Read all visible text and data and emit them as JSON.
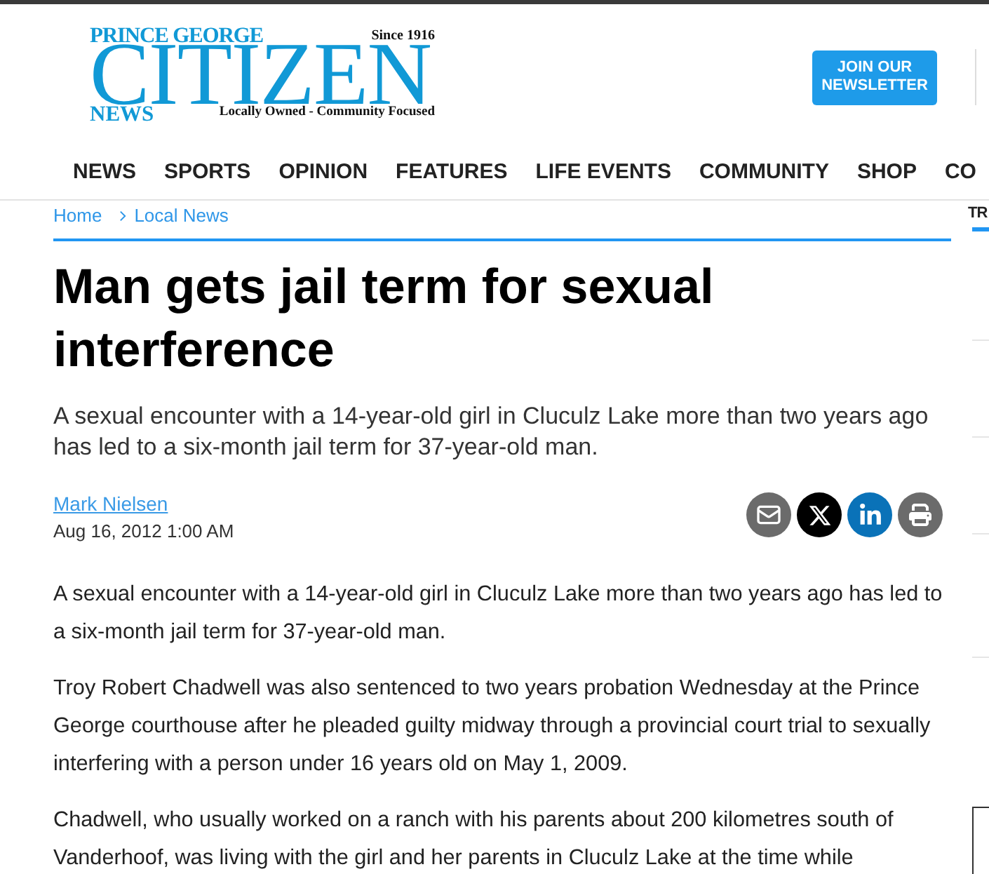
{
  "header": {
    "logo": {
      "top_line": "PRINCE GEORGE",
      "since": "Since 1916",
      "wordmark": "CITIZEN",
      "bottom_line": "NEWS",
      "tagline": "Locally Owned - Community Focused"
    },
    "newsletter_button": "JOIN OUR NEWSLETTER"
  },
  "nav": [
    {
      "label": "NEWS"
    },
    {
      "label": "SPORTS"
    },
    {
      "label": "OPINION"
    },
    {
      "label": "FEATURES"
    },
    {
      "label": "LIFE EVENTS"
    },
    {
      "label": "COMMUNITY"
    },
    {
      "label": "SHOP"
    },
    {
      "label": "CO"
    }
  ],
  "breadcrumb": [
    "Home",
    "Local News"
  ],
  "article": {
    "title": "Man gets jail term for sexual interference",
    "subtitle": "A sexual encounter with a 14-year-old girl in Cluculz Lake more than two years ago has led to a six-month jail term for 37-year-old man.",
    "author": "Mark Nielsen",
    "date": "Aug 16, 2012 1:00 AM",
    "share": [
      {
        "kind": "email"
      },
      {
        "kind": "x"
      },
      {
        "kind": "linkedin"
      },
      {
        "kind": "print"
      }
    ],
    "paragraphs": [
      "A sexual encounter with a 14-year-old girl in Cluculz Lake more than two years ago has led to a six-month jail term for 37-year-old man.",
      "Troy Robert Chadwell was also sentenced to two years probation Wednesday at the Prince George courthouse after he pleaded guilty midway through a provincial court trial to sexually interfering with a person under 16 years old on May 1, 2009.",
      "Chadwell, who usually worked on a ranch with his parents about 200 kilometres south of Vanderhoof, was living with the girl and her parents in Cluculz Lake at the time while"
    ]
  },
  "sidebar": {
    "heading": "TR"
  }
}
